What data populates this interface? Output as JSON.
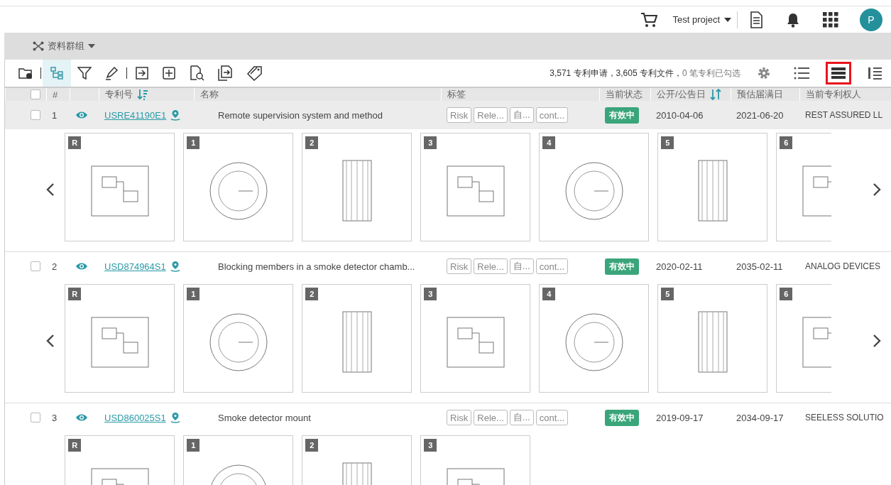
{
  "header": {
    "project": "Test project",
    "avatar": "P"
  },
  "group_bar": {
    "label": "资料群组"
  },
  "toolbar": {
    "summary": "3,571 专利申请，3,605 专利文件，",
    "selected_count": "0 笔专利已勾选",
    "tree_view_selected": true,
    "views": [
      {
        "kind": "list",
        "selected": false
      },
      {
        "kind": "rows",
        "selected": true
      },
      {
        "kind": "split",
        "selected": false
      }
    ]
  },
  "table": {
    "select_all_checked": false,
    "columns": [
      {
        "kind": "check"
      },
      {
        "kind": "text",
        "label": "#"
      },
      {
        "kind": "blank"
      },
      {
        "kind": "sort",
        "label": "专利号"
      },
      {
        "kind": "text",
        "label": "名称"
      },
      {
        "kind": "text",
        "label": "标签"
      },
      {
        "kind": "text",
        "label": "当前状态"
      },
      {
        "kind": "sortdate",
        "label": "公开/公告日"
      },
      {
        "kind": "text",
        "label": "预估届满日"
      },
      {
        "kind": "text",
        "label": "当前专利权人"
      }
    ],
    "rows": [
      {
        "checked": false,
        "highlighted": true,
        "index": "1",
        "number": "USRE41190E1",
        "title": "Remote supervision system and method",
        "tags": [
          "Risk",
          "Rele...",
          "自...",
          "cont..."
        ],
        "status": "有效中",
        "pub_date": "2010-04-06",
        "expiry": "2021-06-20",
        "assignee": "REST ASSURED LL",
        "figures": [
          "R",
          "1",
          "2",
          "3",
          "4",
          "5",
          "6"
        ]
      },
      {
        "checked": false,
        "highlighted": false,
        "index": "2",
        "number": "USD874964S1",
        "title": "Blocking members in a smoke detector chamb...",
        "tags": [
          "Risk",
          "Rele...",
          "自...",
          "cont..."
        ],
        "status": "有效中",
        "pub_date": "2020-02-11",
        "expiry": "2035-02-11",
        "assignee": "ANALOG DEVICES",
        "figures": [
          "R",
          "1",
          "2",
          "3",
          "4",
          "5",
          "6"
        ]
      },
      {
        "checked": false,
        "highlighted": false,
        "index": "3",
        "number": "USD860025S1",
        "title": "Smoke detector mount",
        "tags": [
          "Risk",
          "Rele...",
          "自...",
          "cont..."
        ],
        "status": "有效中",
        "pub_date": "2019-09-17",
        "expiry": "2034-09-17",
        "assignee": "SEELESS SOLUTIO",
        "figures": [
          "R",
          "1",
          "2",
          "3"
        ]
      }
    ]
  }
}
